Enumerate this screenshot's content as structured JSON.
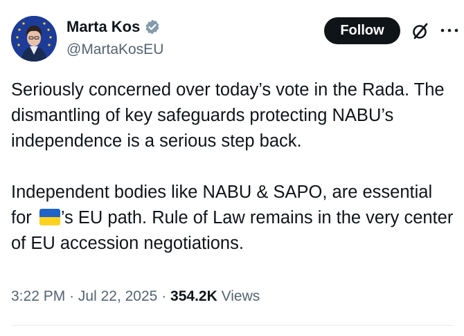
{
  "author": {
    "display_name": "Marta Kos",
    "handle": "@MartaKosEU",
    "verified": true,
    "verified_color": "#829aab"
  },
  "header": {
    "follow_label": "Follow",
    "grok_icon": "grok-slash-icon",
    "more_icon": "more-dots-icon"
  },
  "tweet": {
    "paragraph1": "Seriously concerned over today’s vote in the Rada. The dismantling of key safeguards protecting NABU’s independence is a serious step back.",
    "paragraph2_before_flag": "Independent bodies like NABU & SAPO, are essential for ",
    "flag_icon": "ukraine-flag-icon",
    "paragraph2_after_flag": "’s EU path. Rule of Law remains in the very center of EU accession negotiations."
  },
  "meta": {
    "time": "3:22 PM",
    "separator": "·",
    "date": "Jul 22, 2025",
    "views_count": "354.2K",
    "views_label": "Views"
  },
  "colors": {
    "text_primary": "#0f1419",
    "text_secondary": "#536471",
    "follow_bg": "#0f1419",
    "flag_blue": "#1f63c9",
    "flag_yellow": "#ffd21f"
  }
}
